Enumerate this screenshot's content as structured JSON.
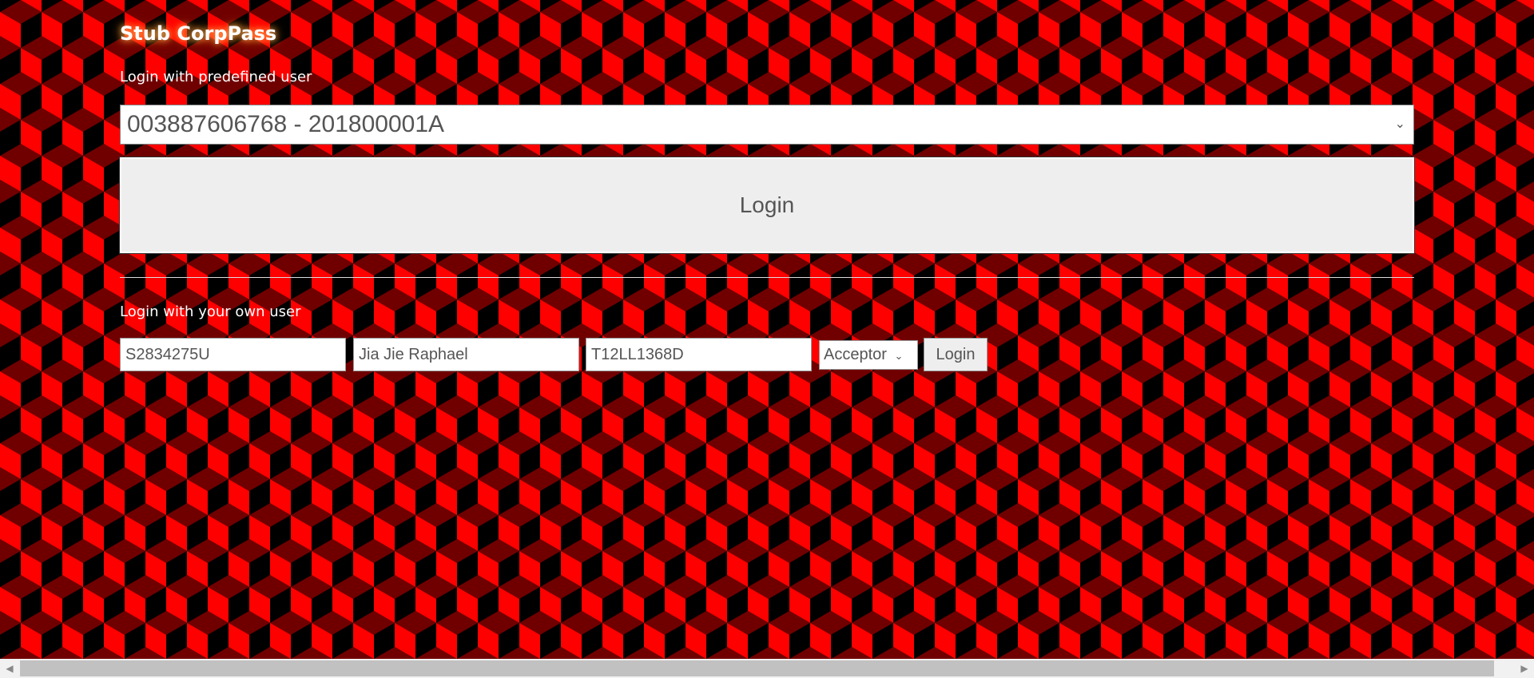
{
  "title": "Stub CorpPass",
  "predefined": {
    "label": "Login with predefined user",
    "selected_user": "003887606768 - 201800001A",
    "login_label": "Login"
  },
  "own_user": {
    "label": "Login with your own user",
    "field1_value": "S2834275U",
    "field2_value": "Jia Jie Raphael",
    "field3_value": "T12LL1368D",
    "role_selected": "Acceptor",
    "login_label": "Login"
  },
  "colors": {
    "face_light": "#ff0000",
    "face_dark": "#700000",
    "face_black": "#000000"
  }
}
